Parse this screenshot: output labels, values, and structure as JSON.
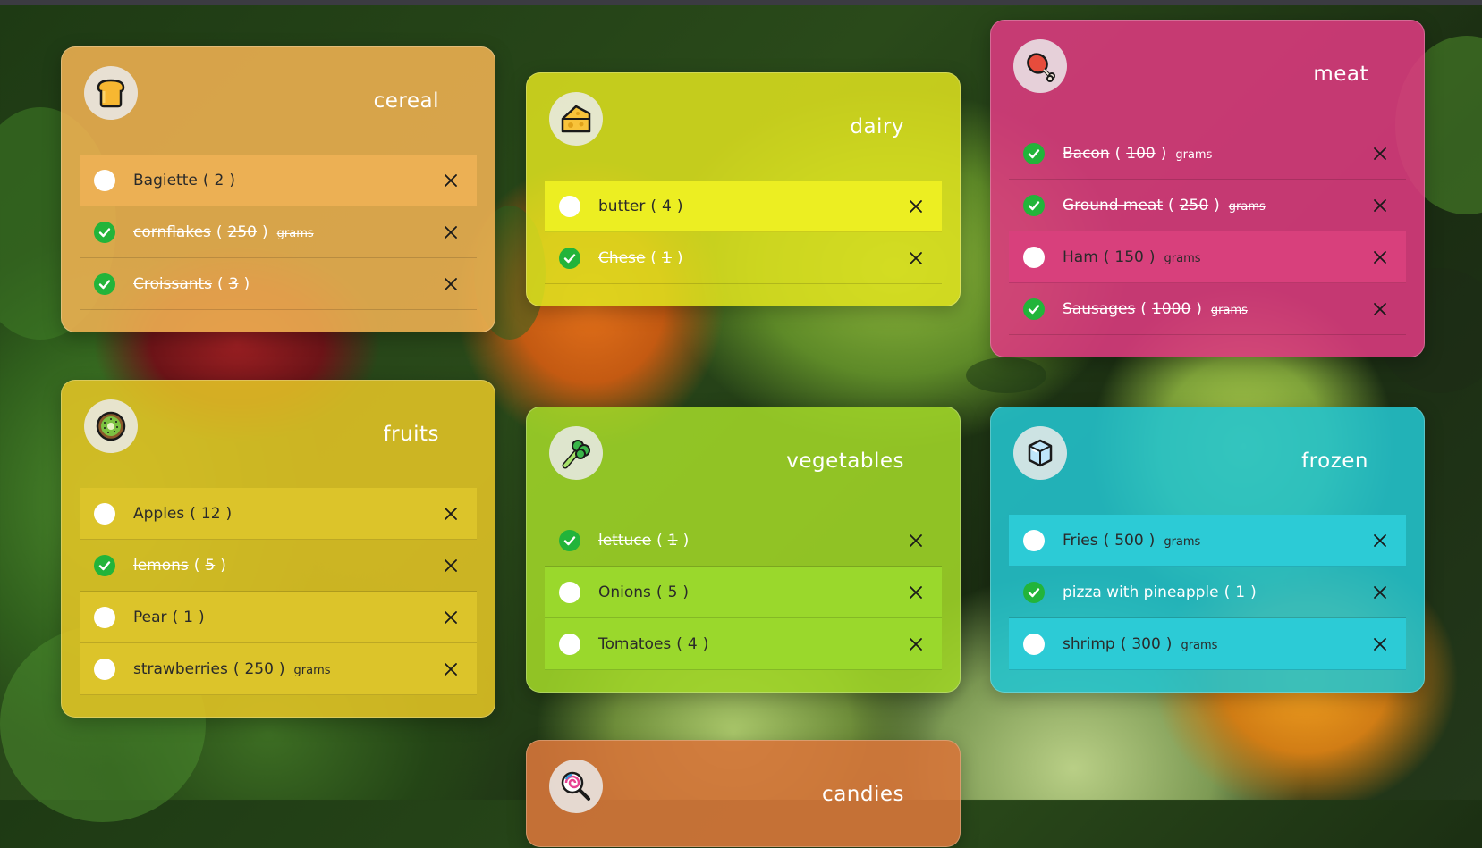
{
  "cards": {
    "cereal": {
      "title": "cereal",
      "icon": "bread-icon",
      "accent": "#f0b252",
      "items": [
        {
          "name": "Bagiette",
          "qty": "2",
          "unit": "",
          "done": false
        },
        {
          "name": "cornflakes",
          "qty": "250",
          "unit": "grams",
          "done": true
        },
        {
          "name": "Croissants",
          "qty": "3",
          "unit": "",
          "done": true
        }
      ]
    },
    "dairy": {
      "title": "dairy",
      "icon": "cheese-icon",
      "accent": "#dee21e",
      "items": [
        {
          "name": "butter",
          "qty": "4",
          "unit": "",
          "done": false
        },
        {
          "name": "Chese",
          "qty": "1",
          "unit": "",
          "done": true
        }
      ]
    },
    "meat": {
      "title": "meat",
      "icon": "meat-icon",
      "accent": "#dd3a80",
      "items": [
        {
          "name": "Bacon",
          "qty": "100",
          "unit": "grams",
          "done": true
        },
        {
          "name": "Ground meat",
          "qty": "250",
          "unit": "grams",
          "done": true
        },
        {
          "name": "Ham",
          "qty": "150",
          "unit": "grams",
          "done": false
        },
        {
          "name": "Sausages",
          "qty": "1000",
          "unit": "grams",
          "done": true
        }
      ]
    },
    "fruits": {
      "title": "fruits",
      "icon": "kiwi-icon",
      "accent": "#e2c424",
      "items": [
        {
          "name": "Apples",
          "qty": "12",
          "unit": "",
          "done": false
        },
        {
          "name": "lemons",
          "qty": "5",
          "unit": "",
          "done": true
        },
        {
          "name": "Pear",
          "qty": "1",
          "unit": "",
          "done": false
        },
        {
          "name": "strawberries",
          "qty": "250",
          "unit": "grams",
          "done": false
        }
      ]
    },
    "vegetables": {
      "title": "vegetables",
      "icon": "broccoli-icon",
      "accent": "#a0d628",
      "items": [
        {
          "name": "lettuce",
          "qty": "1",
          "unit": "",
          "done": true
        },
        {
          "name": "Onions",
          "qty": "5",
          "unit": "",
          "done": false
        },
        {
          "name": "Tomatoes",
          "qty": "4",
          "unit": "",
          "done": false
        }
      ]
    },
    "frozen": {
      "title": "frozen",
      "icon": "ice-cube-icon",
      "accent": "#23c4ce",
      "items": [
        {
          "name": "Fries",
          "qty": "500",
          "unit": "grams",
          "done": false
        },
        {
          "name": "pizza with pineapple",
          "qty": "1",
          "unit": "",
          "done": true
        },
        {
          "name": "shrimp",
          "qty": "300",
          "unit": "grams",
          "done": false
        }
      ]
    },
    "candies": {
      "title": "candies",
      "icon": "lollipop-icon",
      "accent": "#d6763a",
      "items": []
    }
  },
  "colors": {
    "check_done": "#22b43a",
    "check_open": "#ffffff",
    "title_text": "#ffffff"
  }
}
